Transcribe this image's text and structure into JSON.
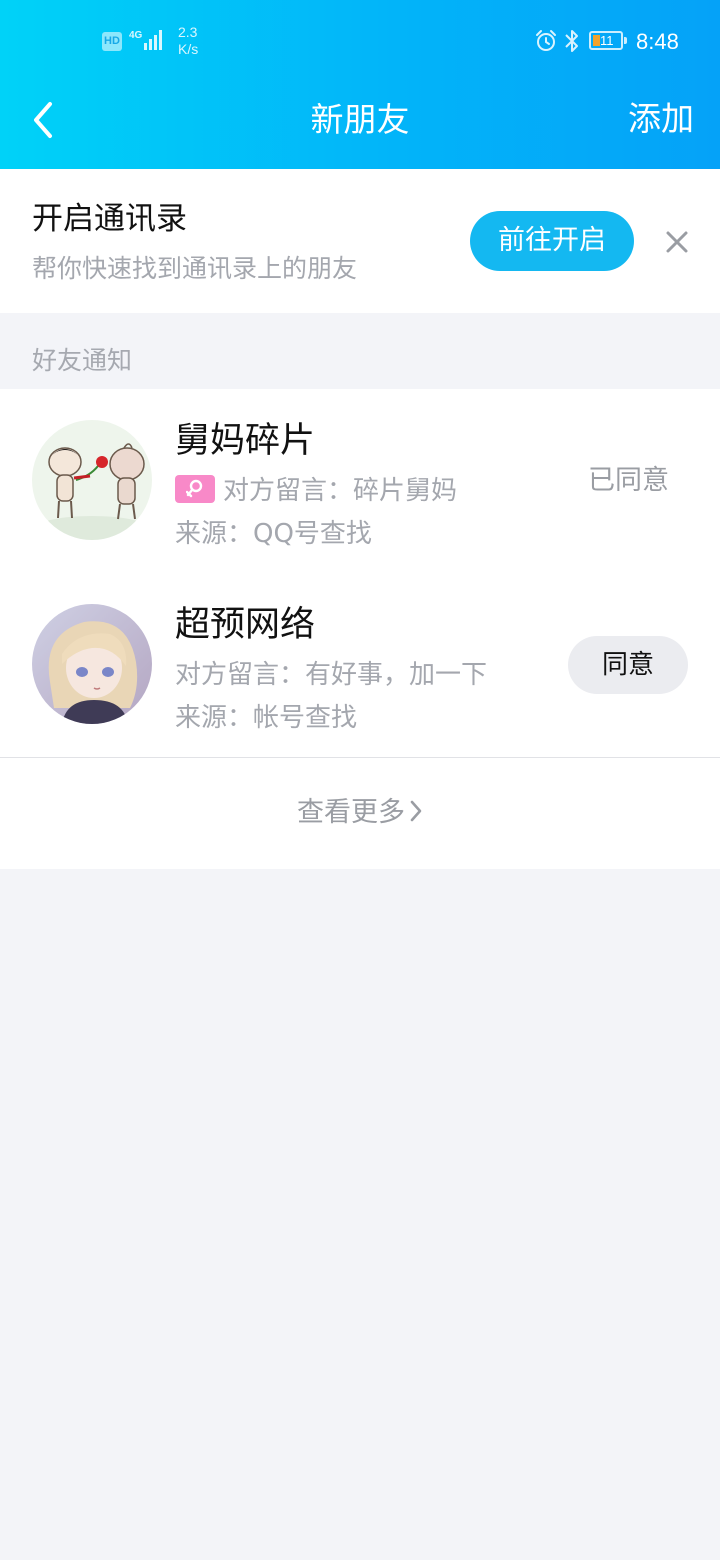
{
  "status_bar": {
    "hd": "HD",
    "network": "4G",
    "speed_value": "2.3",
    "speed_unit": "K/s",
    "battery": "11",
    "time": "8:48"
  },
  "nav": {
    "title": "新朋友",
    "add_label": "添加"
  },
  "contacts_banner": {
    "title": "开启通讯录",
    "subtitle": "帮你快速找到通讯录上的朋友",
    "button_label": "前往开启"
  },
  "section": {
    "label": "好友通知"
  },
  "notifications": [
    {
      "name": "舅妈碎片",
      "gender": "female",
      "message": "对方留言：碎片舅妈",
      "source": "来源：QQ号查找",
      "status": "已同意"
    },
    {
      "name": "超预网络",
      "message": "对方留言：有好事，加一下",
      "source": "来源：帐号查找",
      "action_label": "同意"
    }
  ],
  "more": {
    "label": "查看更多"
  },
  "colors": {
    "header_gradient_start": "#00d2f8",
    "header_gradient_end": "#05a2f8",
    "accent_button": "#14b8f1",
    "female_badge": "#f889c8",
    "page_background": "#f3f4f8"
  }
}
